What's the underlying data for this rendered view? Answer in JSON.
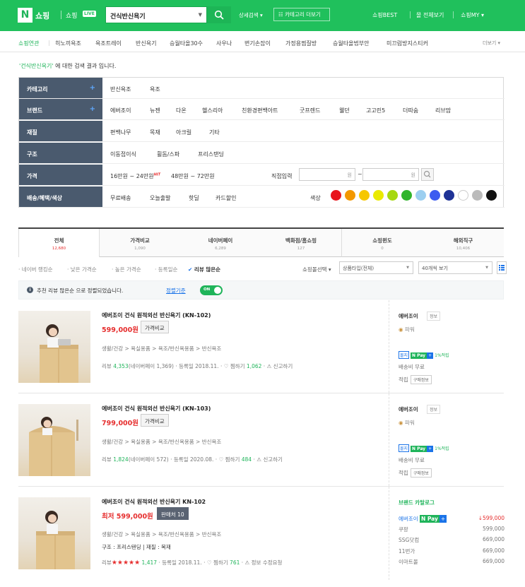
{
  "header": {
    "logo": "N",
    "brand": "쇼핑",
    "live": "쇼핑",
    "live_badge": "LIVE",
    "search_value": "건식반신욕기",
    "detail_search": "상세검색 ▾",
    "category_more": "☷ 카테고리 더보기",
    "links": [
      "쇼핑BEST",
      "몰 전체보기",
      "쇼핑MY ▾"
    ]
  },
  "keywords": [
    "쇼핑연관",
    "히노끼욕조",
    "욕조트레이",
    "반신욕기",
    "승월타올30수",
    "사우나",
    "변기손잡이",
    "가정용찜질방",
    "승월타올법부안",
    "미끄럼방지스티커"
  ],
  "keywords_more": "더보기 ▾",
  "result_message": {
    "query": "'건식반신욕기'",
    "suffix": " 에 대한 검색 결과 입니다."
  },
  "filters": {
    "category": {
      "label": "카테고리",
      "plus": "+",
      "options": [
        "반신욕조",
        "욕조"
      ]
    },
    "brand": {
      "label": "브랜드",
      "plus": "+",
      "options": [
        "에버조이",
        "뉴젠",
        "다온",
        "헬스리아",
        "친환경편백아트",
        "굿프렌드",
        "웰던",
        "고고린5",
        "더따숨",
        "리브맘"
      ]
    },
    "material": {
      "label": "재질",
      "options": [
        "편백나무",
        "목재",
        "아크릴",
        "기타"
      ]
    },
    "structure": {
      "label": "구조",
      "options": [
        "이동접이식",
        "휠돔/스파",
        "프리스탠딩"
      ]
    },
    "price": {
      "label": "가격",
      "options": [
        "16만원 ~ 24만원",
        "48만원 ~ 72만원"
      ],
      "hit": "HIT",
      "direct": "직접입력",
      "won": "원",
      "tilde": "~"
    },
    "shipping": {
      "label": "배송/혜택/색상",
      "options": [
        "무료배송",
        "오늘출발",
        "핫딜",
        "카드할인"
      ],
      "color_label": "색상"
    }
  },
  "colors": [
    "#e8141b",
    "#f39800",
    "#f6c700",
    "#eaea00",
    "#a6d810",
    "#30b42c",
    "#9ccff0",
    "#3d5cf0",
    "#1e3296",
    "#ffffff",
    "#bbbbbb",
    "#111111"
  ],
  "tabs": [
    {
      "name": "전체",
      "count": "12,680"
    },
    {
      "name": "가격비교",
      "count": "1,090"
    },
    {
      "name": "네이버페이",
      "count": "6,289"
    },
    {
      "name": "백화점/홈쇼핑",
      "count": "127"
    },
    {
      "name": "쇼핑윈도",
      "count": "0"
    },
    {
      "name": "해외직구",
      "count": "10,406"
    }
  ],
  "sort": [
    "· 네이버 랭킹순",
    "· 낮은 가격순",
    "· 높은 가격순",
    "· 등록일순",
    "리뷰 많은순"
  ],
  "sort_check": "✔",
  "mall_select": "쇼핑몰선택 ▾",
  "type_select": "상품타입(전체)",
  "count_select": "40개씩 보기",
  "notice": {
    "icon": "i",
    "text": "추천 리뷰 많은순 으로 정렬되었습니다.",
    "link": "정렬기준",
    "toggle": "ON"
  },
  "products": [
    {
      "name": "에버조이 건식 원적외선 반신욕기 (KN-102)",
      "price": "599,000원",
      "button": "가격비교",
      "category": "생활/건강 > 욕실용품 > 욕조/반신욕용품 > 반신욕조",
      "review_label": "리뷰",
      "review": "4,353",
      "npay_reviews": "(네이버페이 1,369)",
      "date": "· 등록일 2018.11.",
      "zzim": "· ♡ 찜하기",
      "zzim_count": "1,062",
      "report": "· ⚠ 신고하기",
      "mall": "에버조이",
      "info": "정보",
      "grade": "파워",
      "badge_mall": "몰지",
      "badge_n": "N Pay",
      "badge_plus": "+",
      "point": "1%적립",
      "ship": "배송비 무료",
      "reward": "적립",
      "reward_tag": "구매정보"
    },
    {
      "name": "에버조이 건식 원적외선 반신욕기 (KN-103)",
      "price": "799,000원",
      "button": "가격비교",
      "category": "생활/건강 > 욕실용품 > 욕조/반신욕용품 > 반신욕조",
      "review_label": "리뷰",
      "review": "1,824",
      "npay_reviews": "(네이버페이 572)",
      "date": "· 등록일 2020.08.",
      "zzim": "· ♡ 찜하기",
      "zzim_count": "484",
      "report": "· ⚠ 신고하기",
      "mall": "에버조이",
      "info": "정보",
      "grade": "파워",
      "badge_mall": "몰지",
      "badge_n": "N Pay",
      "badge_plus": "+",
      "point": "1%적립",
      "ship": "배송비 무료",
      "reward": "적립",
      "reward_tag": "구매정보"
    },
    {
      "name": "에버조이 건식 원적외선 반신욕기 KN-102",
      "price": "최저 599,000원",
      "button": "판매처 10",
      "category": "생활/건강 > 욕실용품 > 욕조/반신욕용품 > 반신욕조",
      "spec": "구조 : 프리스탠딩  |  재질 : 목재",
      "review_label": "리뷰",
      "stars": "★★★★★",
      "rating": 5,
      "review": "1,417",
      "date": "· 등록일 2018.11.",
      "zzim": "· ♡ 찜하기",
      "zzim_count": "761",
      "report": "· ⚠ 정보 수정요청",
      "catalog": "브랜드 카탈로그",
      "sellers": [
        {
          "name": "에버조이",
          "price": "↓599,000",
          "best": true
        },
        {
          "name": "쿠팡",
          "price": "599,000"
        },
        {
          "name": "SSG닷컴",
          "price": "669,000"
        },
        {
          "name": "11번가",
          "price": "669,000"
        },
        {
          "name": "이마트몰",
          "price": "669,000"
        }
      ]
    }
  ]
}
